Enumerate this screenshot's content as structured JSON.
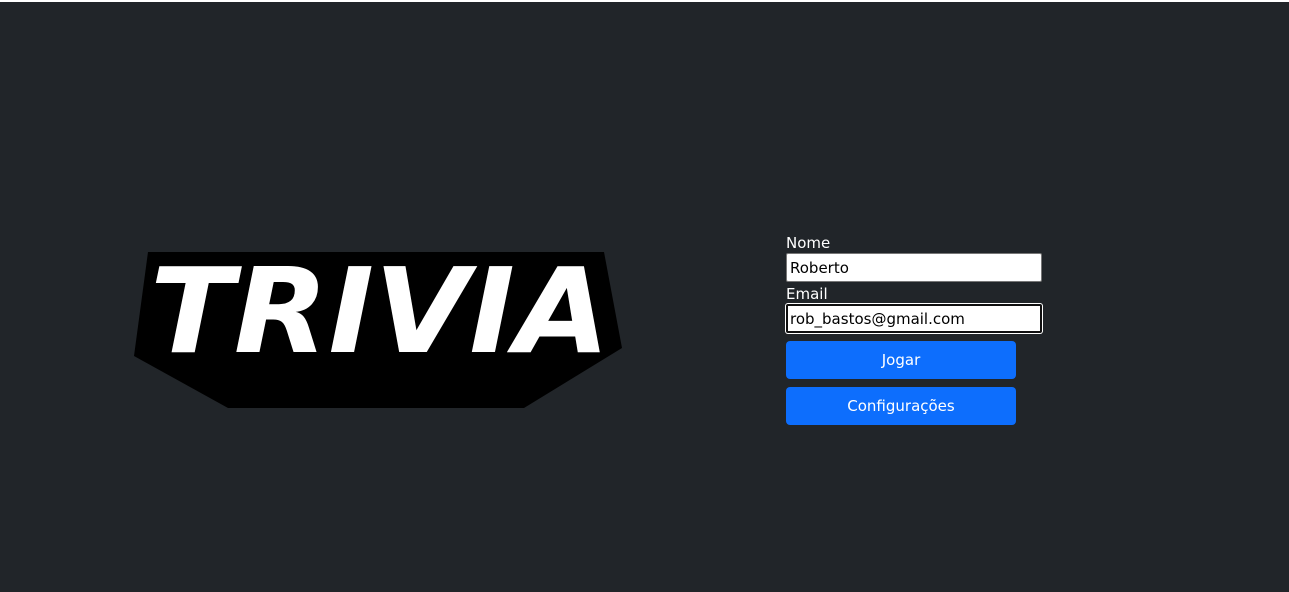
{
  "logo": {
    "text": "TRIVIA",
    "fill_color": "#ffffff",
    "outline_color": "#000000"
  },
  "login_form": {
    "name_label": "Nome",
    "name_value": "Roberto",
    "email_label": "Email",
    "email_value": "rob_bastos@gmail.com",
    "play_button_label": "Jogar",
    "settings_button_label": "Configurações"
  },
  "colors": {
    "background": "#212529",
    "accent": "#0d6efd"
  }
}
